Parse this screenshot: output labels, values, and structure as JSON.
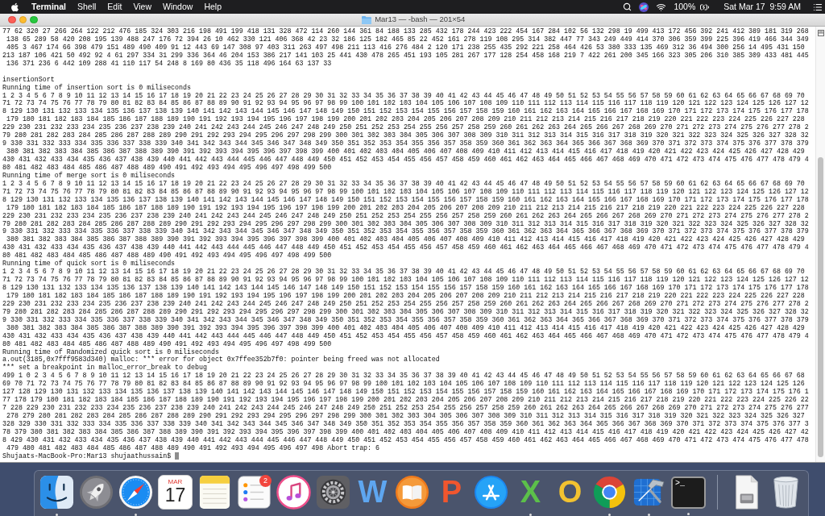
{
  "menu_bar": {
    "app_menu": "Terminal",
    "menus": [
      "Shell",
      "Edit",
      "View",
      "Window",
      "Help"
    ],
    "battery": "100%",
    "clock": "Sat Mar 17  9:59 AM"
  },
  "window": {
    "title": "Mar13 — -bash — 201×54",
    "array_output": [
      "77 62 320 27 266 264 122 212 476 185 324 303 216 198 491 199 418 131 328 472 114 260 144 361 84 188 133 285 432 178 244 423 222 454 167 284 102 56 132 298 19 499 413 172 456 392 241 412 389 181 319 268",
      " 138 65 289 58 420 208 195 139 488 247 176 72 394 26 10 462 330 121 406 368 42 23 32 186 125 182 465 85 22 452 161 278 119 108 295 314 382 447 77 343 249 449 414 370 306 359 399 225 396 419 466 344 349",
      " 405 3 467 174 66 398 479 151 489 490 409 91 12 443 69 147 308 97 403 311 263 497 498 211 113 416 276 484 2 120 171 238 255 435 292 221 258 464 426 53 380 333 135 469 312 36 494 300 256 14 495 431 150",
      "213 187 106 421 50 492 92 4 61 297 334 31 299 336 364 46 204 153 386 217 141 103 25 441 430 478 265 451 193 105 281 267 177 128 254 458 168 219 7 422 261 200 345 166 323 305 206 310 385 309 433 481 445",
      " 136 371 236 6 442 109 288 41 110 117 54 248 8 169 80 436 35 118 496 164 63 137 33"
    ],
    "program_output": [
      "insertionSort",
      "Running time of insertion sort is 0 miliseconds",
      "1 2 3 4 5 6 7 8 9 10 11 12 13 14 15 16 17 18 19 20 21 22 23 24 25 26 27 28 29 30 31 32 33 34 35 36 37 38 39 40 41 42 43 44 45 46 47 48 49 50 51 52 53 54 55 56 57 58 59 60 61 62 63 64 65 66 67 68 69 70",
      "71 72 73 74 75 76 77 78 79 80 81 82 83 84 85 86 87 88 89 90 91 92 93 94 95 96 97 98 99 100 101 102 103 104 105 106 107 108 109 110 111 112 113 114 115 116 117 118 119 120 121 122 123 124 125 126 127 12",
      "8 129 130 131 132 133 134 135 136 137 138 139 140 141 142 143 144 145 146 147 148 149 150 151 152 153 154 155 156 157 158 159 160 161 162 163 164 165 166 167 168 169 170 171 172 173 174 175 176 177 178",
      " 179 180 181 182 183 184 185 186 187 188 189 190 191 192 193 194 195 196 197 198 199 200 201 202 203 204 205 206 207 208 209 210 211 212 213 214 215 216 217 218 219 220 221 222 223 224 225 226 227 228",
      "229 230 231 232 233 234 235 236 237 238 239 240 241 242 243 244 245 246 247 248 249 250 251 252 253 254 255 256 257 258 259 260 261 262 263 264 265 266 267 268 269 270 271 272 273 274 275 276 277 278 2",
      "79 280 281 282 283 284 285 286 287 288 289 290 291 292 293 294 295 296 297 298 299 300 301 302 303 304 305 306 307 308 309 310 311 312 313 314 315 316 317 318 319 320 321 322 323 324 325 326 327 328 32",
      "9 330 331 332 333 334 335 336 337 338 339 340 341 342 343 344 345 346 347 348 349 350 351 352 353 354 355 356 357 358 359 360 361 362 363 364 365 366 367 368 369 370 371 372 373 374 375 376 377 378 379",
      " 380 381 382 383 384 385 386 387 388 389 390 391 392 393 394 395 396 397 398 399 400 401 402 403 404 405 406 407 408 409 410 411 412 413 414 415 416 417 418 419 420 421 422 423 424 425 426 427 428 429",
      "430 431 432 433 434 435 436 437 438 439 440 441 442 443 444 445 446 447 448 449 450 451 452 453 454 455 456 457 458 459 460 461 462 463 464 465 466 467 468 469 470 471 472 473 474 475 476 477 478 479 4",
      "80 481 482 483 484 485 486 487 488 489 490 491 492 493 494 495 496 497 498 499 500",
      "Running time of merge sort is 0 miliseconds",
      "1 2 3 4 5 6 7 8 9 10 11 12 13 14 15 16 17 18 19 20 21 22 23 24 25 26 27 28 29 30 31 32 33 34 35 36 37 38 39 40 41 42 43 44 45 46 47 48 49 50 51 52 53 54 55 56 57 58 59 60 61 62 63 64 65 66 67 68 69 70",
      "71 72 73 74 75 76 77 78 79 80 81 82 83 84 85 86 87 88 89 90 91 92 93 94 95 96 97 98 99 100 101 102 103 104 105 106 107 108 109 110 111 112 113 114 115 116 117 118 119 120 121 122 123 124 125 126 127 12",
      "8 129 130 131 132 133 134 135 136 137 138 139 140 141 142 143 144 145 146 147 148 149 150 151 152 153 154 155 156 157 158 159 160 161 162 163 164 165 166 167 168 169 170 171 172 173 174 175 176 177 178",
      " 179 180 181 182 183 184 185 186 187 188 189 190 191 192 193 194 195 196 197 198 199 200 201 202 203 204 205 206 207 208 209 210 211 212 213 214 215 216 217 218 219 220 221 222 223 224 225 226 227 228",
      "229 230 231 232 233 234 235 236 237 238 239 240 241 242 243 244 245 246 247 248 249 250 251 252 253 254 255 256 257 258 259 260 261 262 263 264 265 266 267 268 269 270 271 272 273 274 275 276 277 278 2",
      "79 280 281 282 283 284 285 286 287 288 289 290 291 292 293 294 295 296 297 298 299 300 301 302 303 304 305 306 307 308 309 310 311 312 313 314 315 316 317 318 319 320 321 322 323 324 325 326 327 328 32",
      "9 330 331 332 333 334 335 336 337 338 339 340 341 342 343 344 345 346 347 348 349 350 351 352 353 354 355 356 357 358 359 360 361 362 363 364 365 366 367 368 369 370 371 372 373 374 375 376 377 378 379",
      " 380 381 382 383 384 385 386 387 388 389 390 391 392 393 394 395 396 397 398 399 400 401 402 403 404 405 406 407 408 409 410 411 412 413 414 415 416 417 418 419 420 421 422 423 424 425 426 427 428 429",
      "430 431 432 433 434 435 436 437 438 439 440 441 442 443 444 445 446 447 448 449 450 451 452 453 454 455 456 457 458 459 460 461 462 463 464 465 466 467 468 469 470 471 472 473 474 475 476 477 478 479 4",
      "80 481 482 483 484 485 486 487 488 489 490 491 492 493 494 495 496 497 498 499 500",
      "Running time of quick sort is 0 miliseconds",
      "1 2 3 4 5 6 7 8 9 10 11 12 13 14 15 16 17 18 19 20 21 22 23 24 25 26 27 28 29 30 31 32 33 34 35 36 37 38 39 40 41 42 43 44 45 46 47 48 49 50 51 52 53 54 55 56 57 58 59 60 61 62 63 64 65 66 67 68 69 70",
      "71 72 73 74 75 76 77 78 79 80 81 82 83 84 85 86 87 88 89 90 91 92 93 94 95 96 97 98 99 100 101 102 103 104 105 106 107 108 109 110 111 112 113 114 115 116 117 118 119 120 121 122 123 124 125 126 127 12",
      "8 129 130 131 132 133 134 135 136 137 138 139 140 141 142 143 144 145 146 147 148 149 150 151 152 153 154 155 156 157 158 159 160 161 162 163 164 165 166 167 168 169 170 171 172 173 174 175 176 177 178",
      " 179 180 181 182 183 184 185 186 187 188 189 190 191 192 193 194 195 196 197 198 199 200 201 202 203 204 205 206 207 208 209 210 211 212 213 214 215 216 217 218 219 220 221 222 223 224 225 226 227 228",
      "229 230 231 232 233 234 235 236 237 238 239 240 241 242 243 244 245 246 247 248 249 250 251 252 253 254 255 256 257 258 259 260 261 262 263 264 265 266 267 268 269 270 271 272 273 274 275 276 277 278 2",
      "79 280 281 282 283 284 285 286 287 288 289 290 291 292 293 294 295 296 297 298 299 300 301 302 303 304 305 306 307 308 309 310 311 312 313 314 315 316 317 318 319 320 321 322 323 324 325 326 327 328 32",
      "9 330 331 332 333 334 335 336 337 338 339 340 341 342 343 344 345 346 347 348 349 350 351 352 353 354 355 356 357 358 359 360 361 362 363 364 365 366 367 368 369 370 371 372 373 374 375 376 377 378 379",
      " 380 381 382 383 384 385 386 387 388 389 390 391 392 393 394 395 396 397 398 399 400 401 402 403 404 405 406 407 408 409 410 411 412 413 414 415 416 417 418 419 420 421 422 423 424 425 426 427 428 429",
      "430 431 432 433 434 435 436 437 438 439 440 441 442 443 444 445 446 447 448 449 450 451 452 453 454 455 456 457 458 459 460 461 462 463 464 465 466 467 468 469 470 471 472 473 474 475 476 477 478 479 4",
      "80 481 482 483 484 485 486 487 488 489 490 491 492 493 494 495 496 497 498 499 500",
      "Running time of Randomized quick sort is 0 miliseconds",
      "a.out(3185,0x7fff9583d340) malloc: *** error for object 0x7ffee352b7f0: pointer being freed was not allocated",
      "*** set a breakpoint in malloc_error_break to debug",
      "499 1 0 2 3 4 5 6 7 8 9 10 11 12 13 14 15 16 17 18 19 20 21 22 23 24 25 26 27 28 29 30 31 32 33 34 35 36 37 38 39 40 41 42 43 44 45 46 47 48 49 50 51 52 53 54 55 56 57 58 59 60 61 62 63 64 65 66 67 68",
      "69 70 71 72 73 74 75 76 77 78 79 80 81 82 83 84 85 86 87 88 89 90 91 92 93 94 95 96 97 98 99 100 101 102 103 104 105 106 107 108 109 110 111 112 113 114 115 116 117 118 119 120 121 122 123 124 125 126",
      "127 128 129 130 131 132 133 134 135 136 137 138 139 140 141 142 143 144 145 146 147 148 149 150 151 152 153 154 155 156 157 158 159 160 161 162 163 164 165 166 167 168 169 170 171 172 173 174 175 176 1",
      "77 178 179 180 181 182 183 184 185 186 187 188 189 190 191 192 193 194 195 196 197 198 199 200 201 202 203 204 205 206 207 208 209 210 211 212 213 214 215 216 217 218 219 220 221 222 223 224 225 226 22",
      "7 228 229 230 231 232 233 234 235 236 237 238 239 240 241 242 243 244 245 246 247 248 249 250 251 252 253 254 255 256 257 258 259 260 261 262 263 264 265 266 267 268 269 270 271 272 273 274 275 276 277",
      " 278 279 280 281 282 283 284 285 286 287 288 289 290 291 292 293 294 295 296 297 298 299 300 301 302 303 304 305 306 307 308 309 310 311 312 313 314 315 316 317 318 319 320 321 322 323 324 325 326 327",
      "328 329 330 331 332 333 334 335 336 337 338 339 340 341 342 343 344 345 346 347 348 349 350 351 352 353 354 355 356 357 358 359 360 361 362 363 364 365 366 367 368 369 370 371 372 373 374 375 376 377 3",
      "78 379 380 381 382 383 384 385 386 387 388 389 390 391 392 393 394 395 396 397 398 399 400 401 402 403 404 405 406 407 408 409 410 411 412 413 414 415 416 417 418 419 420 421 422 423 424 425 426 427 42",
      "8 429 430 431 432 433 434 435 436 437 438 439 440 441 442 443 444 445 446 447 448 449 450 451 452 453 454 455 456 457 458 459 460 461 462 463 464 465 466 467 468 469 470 471 472 473 474 475 476 477 478",
      " 479 480 481 482 483 484 485 486 487 488 489 490 491 492 493 494 495 496 497 498 Abort trap: 6"
    ],
    "prompt": "Shujaats-MacBook-Pro:Mar13 shujaathussain$"
  },
  "dock": {
    "items": [
      {
        "kind": "face",
        "running": true
      },
      {
        "kind": "rocket",
        "running": false
      },
      {
        "kind": "compass",
        "running": true
      },
      {
        "kind": "calendar",
        "month": "MAR",
        "day": "17",
        "running": false
      },
      {
        "kind": "notepad",
        "running": false
      },
      {
        "kind": "checklist",
        "badge": "2",
        "running": false
      },
      {
        "kind": "music",
        "running": false
      },
      {
        "kind": "gear",
        "running": false
      },
      {
        "kind": "letter",
        "glyph": "W",
        "color": "#5ea6f0",
        "running": false
      },
      {
        "kind": "book",
        "running": false
      },
      {
        "kind": "letter",
        "glyph": "P",
        "color": "#f0562e",
        "running": false
      },
      {
        "kind": "brushes",
        "running": false
      },
      {
        "kind": "letter",
        "glyph": "X",
        "color": "#5cc04a",
        "running": true
      },
      {
        "kind": "letter",
        "glyph": "O",
        "color": "#f2c230",
        "running": false
      },
      {
        "kind": "browser",
        "running": true
      },
      {
        "kind": "hammer",
        "running": true
      },
      {
        "kind": "console",
        "glyph": ">_",
        "running": true
      },
      {
        "kind": "separator"
      },
      {
        "kind": "document",
        "running": false
      },
      {
        "kind": "trash",
        "running": false
      }
    ]
  }
}
